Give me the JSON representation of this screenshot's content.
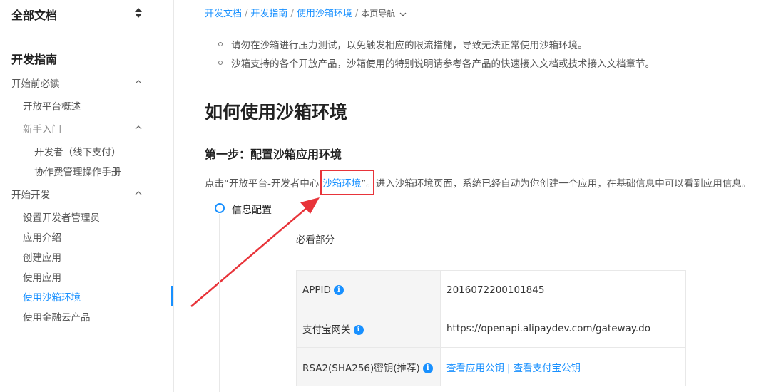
{
  "sidebar": {
    "doc_switch_label": "全部文档",
    "section_title": "开发指南",
    "items": [
      {
        "label": "开始前必读"
      },
      {
        "label": "开放平台概述"
      },
      {
        "label": "新手入门"
      },
      {
        "label": "开发者（线下支付）"
      },
      {
        "label": "协作费管理操作手册"
      },
      {
        "label": "开始开发"
      },
      {
        "label": "设置开发者管理员"
      },
      {
        "label": "应用介绍"
      },
      {
        "label": "创建应用"
      },
      {
        "label": "使用应用"
      },
      {
        "label": "使用沙箱环境"
      },
      {
        "label": "使用金融云产品"
      }
    ]
  },
  "breadcrumb": {
    "items": [
      "开发文档",
      "开发指南",
      "使用沙箱环境"
    ],
    "page_nav_label": "本页导航"
  },
  "content": {
    "bullets": [
      "请勿在沙箱进行压力测试，以免触发相应的限流措施，导致无法正常使用沙箱环境。",
      "沙箱支持的各个开放产品，沙箱使用的特别说明请参考各产品的快速接入文档或技术接入文档章节。"
    ],
    "h1": "如何使用沙箱环境",
    "h2": "第一步：配置沙箱应用环境",
    "para_before": "点击“开放平台-开发者中心-",
    "para_link": "沙箱环境",
    "para_after": "”。进入沙箱环境页面，系统已经自动为你创建一个应用，在基础信息中可以看到应用信息。",
    "step_label": "信息配置",
    "must_see": "必看部分",
    "table": {
      "rows": [
        {
          "key": "APPID",
          "value": "2016072200101845"
        },
        {
          "key": "支付宝网关",
          "value": "https://openapi.alipaydev.com/gateway.do"
        },
        {
          "key": "RSA2(SHA256)密钥(推荐)",
          "link1": "查看应用公钥",
          "sep": "|",
          "link2": "查看支付宝公钥"
        }
      ]
    }
  },
  "colors": {
    "accent": "#1890ff",
    "annotation_red": "#e8343a"
  }
}
